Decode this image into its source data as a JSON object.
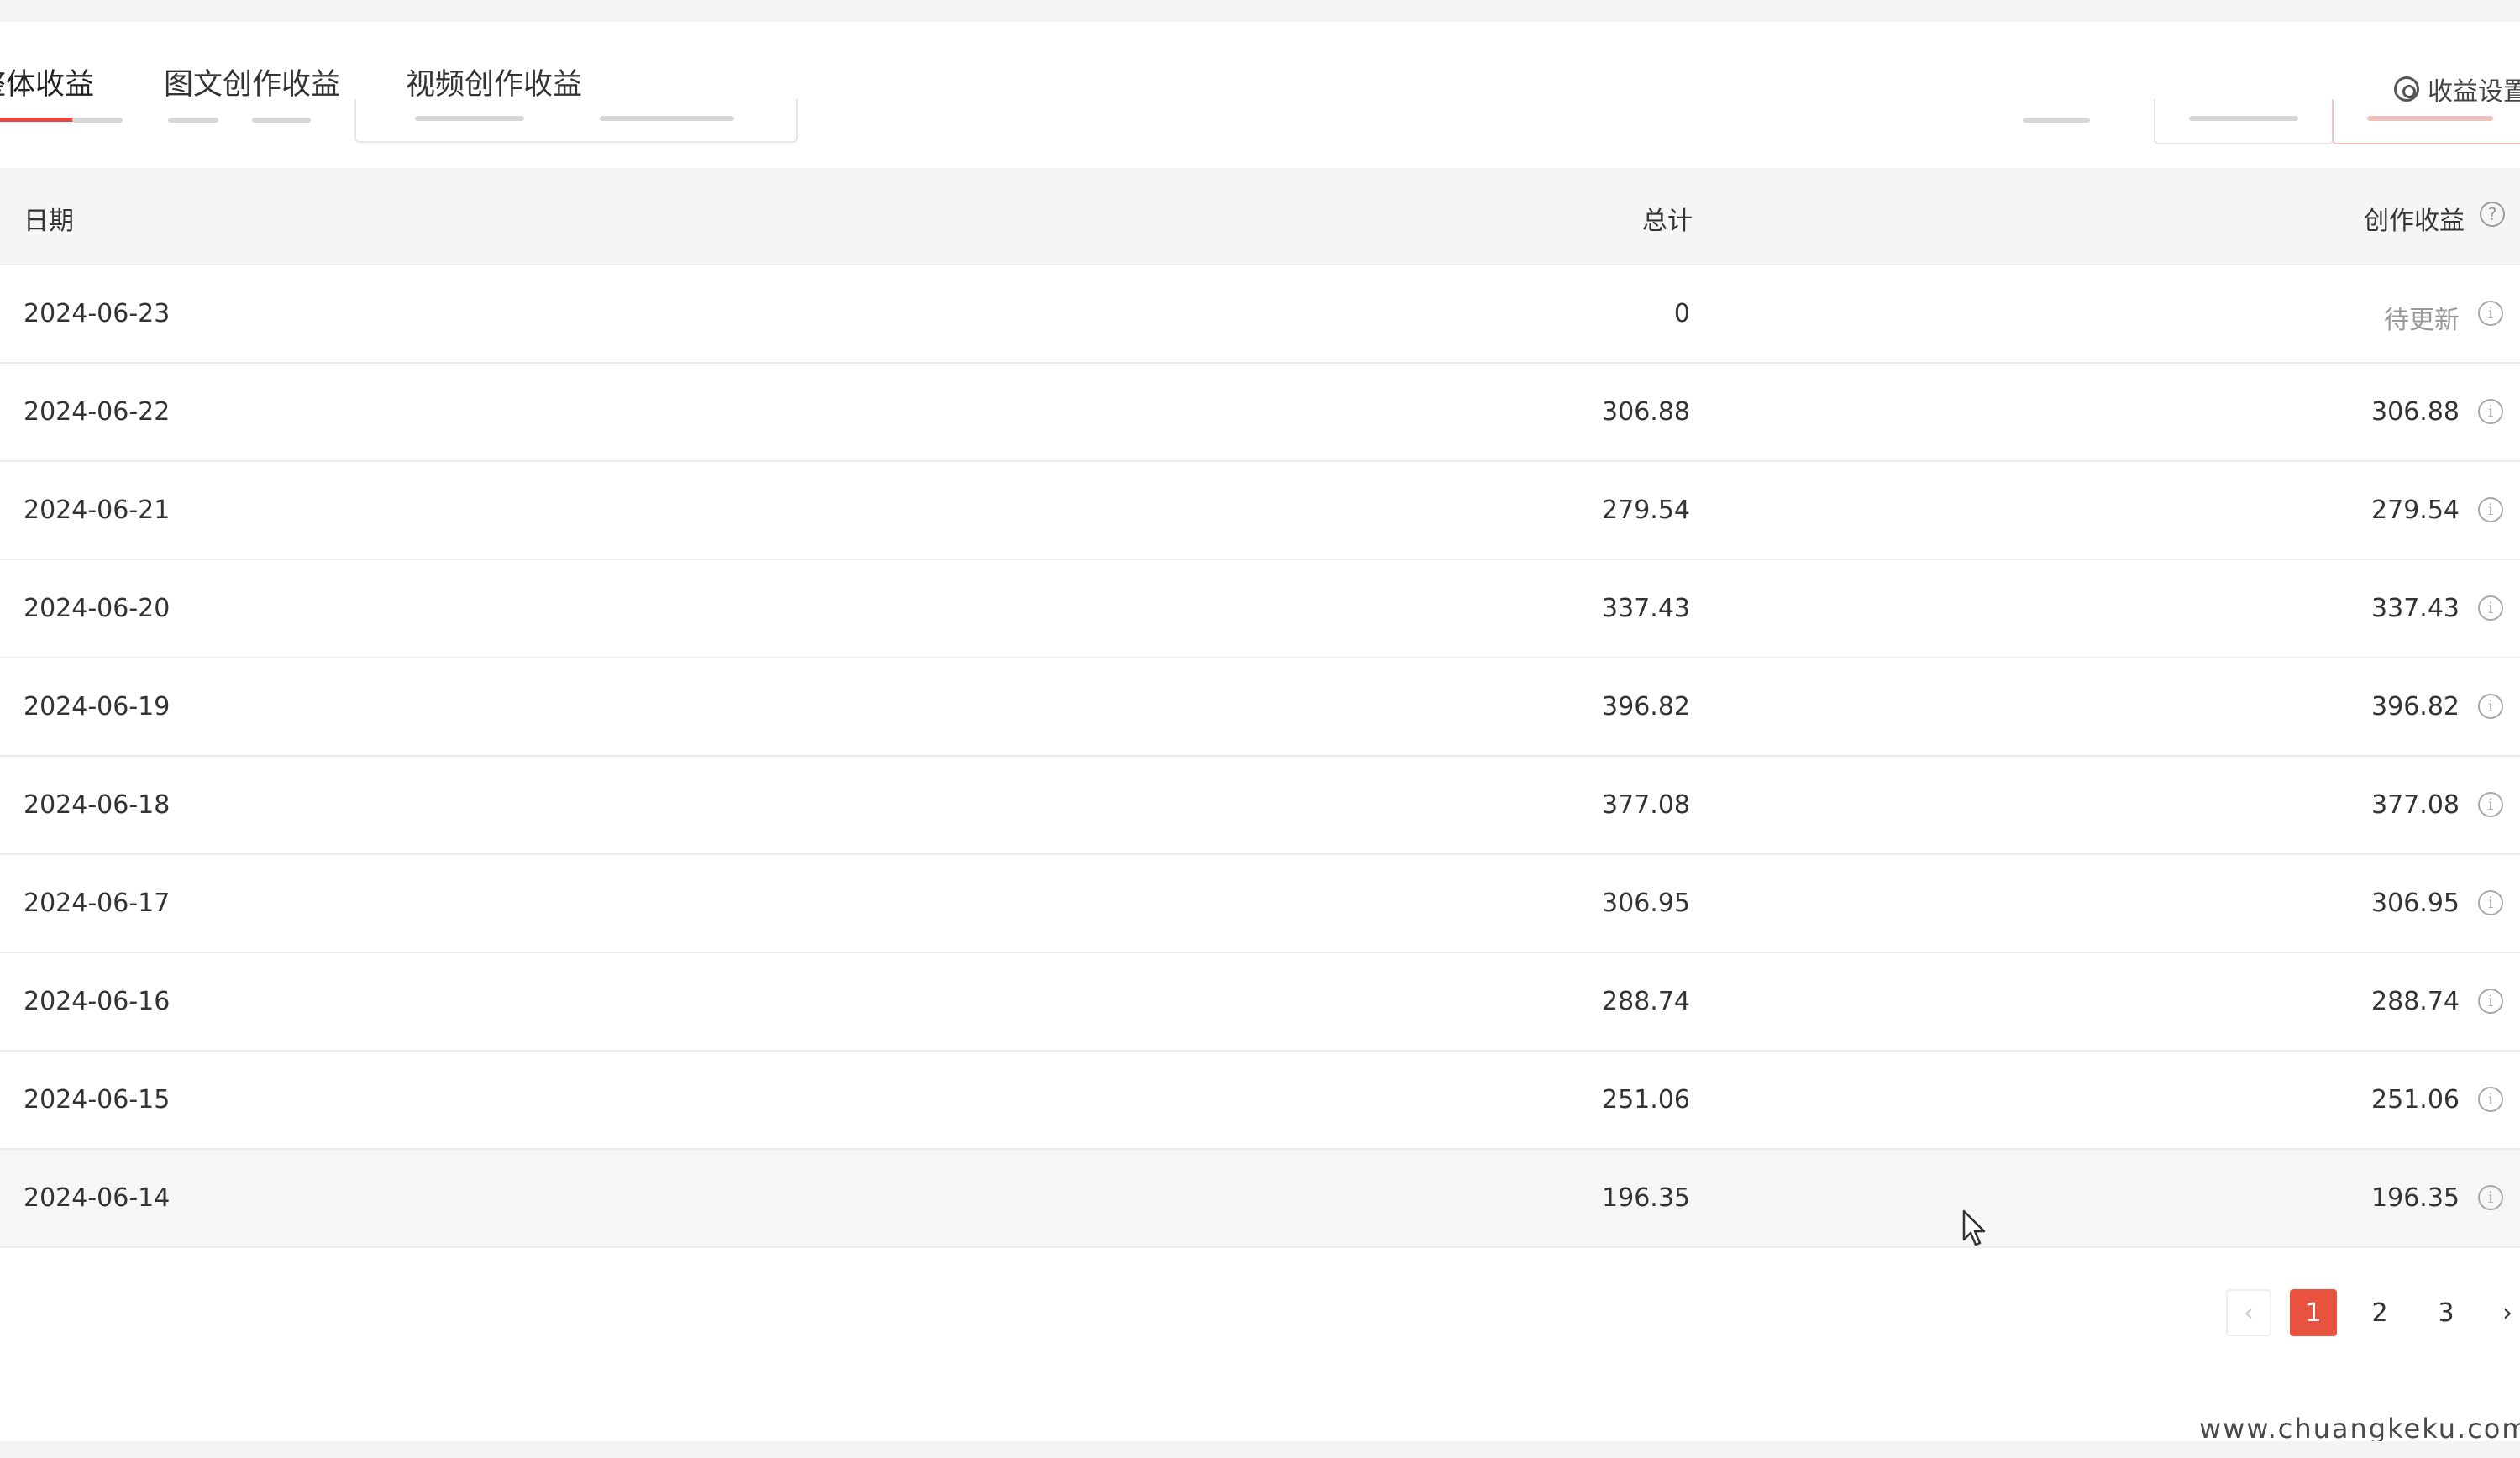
{
  "tabs": [
    {
      "label": "整体收益",
      "active": true
    },
    {
      "label": "图文创作收益",
      "active": false
    },
    {
      "label": "视频创作收益",
      "active": false
    }
  ],
  "settings_label": "收益设置",
  "table": {
    "columns": [
      "日期",
      "总计",
      "创作收益"
    ],
    "rows": [
      {
        "date": "2024-06-23",
        "total": "0",
        "creation": "待更新"
      },
      {
        "date": "2024-06-22",
        "total": "306.88",
        "creation": "306.88"
      },
      {
        "date": "2024-06-21",
        "total": "279.54",
        "creation": "279.54"
      },
      {
        "date": "2024-06-20",
        "total": "337.43",
        "creation": "337.43"
      },
      {
        "date": "2024-06-19",
        "total": "396.82",
        "creation": "396.82"
      },
      {
        "date": "2024-06-18",
        "total": "377.08",
        "creation": "377.08"
      },
      {
        "date": "2024-06-17",
        "total": "306.95",
        "creation": "306.95"
      },
      {
        "date": "2024-06-16",
        "total": "288.74",
        "creation": "288.74"
      },
      {
        "date": "2024-06-15",
        "total": "251.06",
        "creation": "251.06"
      },
      {
        "date": "2024-06-14",
        "total": "196.35",
        "creation": "196.35"
      }
    ]
  },
  "pagination": {
    "prev": "‹",
    "pages": [
      "1",
      "2",
      "3"
    ],
    "current": "1",
    "next": "›"
  },
  "watermark": "www.chuangkeku.com",
  "colors": {
    "accent": "#e8523f",
    "header_bg": "#f5f5f5",
    "pending_text": "#999999"
  }
}
